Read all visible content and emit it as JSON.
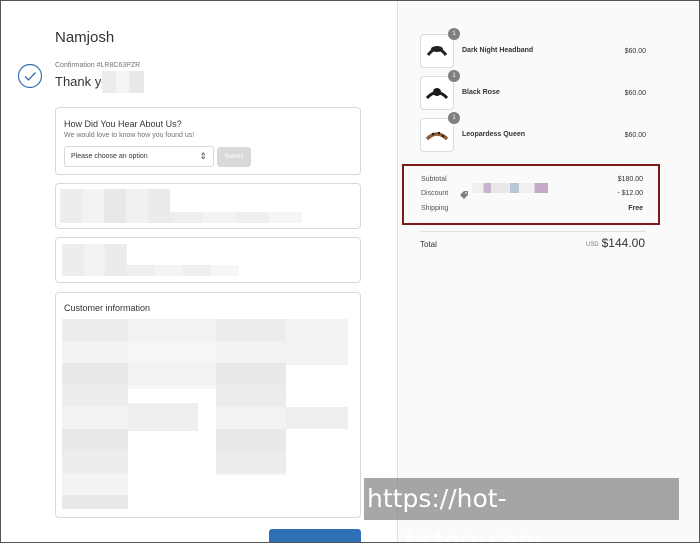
{
  "store": {
    "name": "Namjosh"
  },
  "confirmation": {
    "number": "Confirmation #LR8C63PZR",
    "thank_you": "Thank yo"
  },
  "survey": {
    "title": "How Did You Hear About Us?",
    "subtitle": "We would love to know how you found us!",
    "select_value": "Please choose an option",
    "submit_label": "Submit"
  },
  "customer_info": {
    "title": "Customer information"
  },
  "order": {
    "items": [
      {
        "name": "Dark Night Headband",
        "price": "$60.00",
        "qty": "1",
        "icon": "headband-product-icon"
      },
      {
        "name": "Black Rose",
        "price": "$60.00",
        "qty": "1",
        "icon": "headband-product-icon"
      },
      {
        "name": "Leopardess Queen",
        "price": "$60.00",
        "qty": "1",
        "icon": "headband-product-icon"
      }
    ],
    "summary": {
      "subtotal_label": "Subtotal",
      "subtotal_value": "$180.00",
      "discount_label": "Discount",
      "discount_value": "- $12.00",
      "shipping_label": "Shipping",
      "shipping_value": "Free"
    },
    "total": {
      "label": "Total",
      "currency": "USD",
      "value": "$144.00"
    }
  },
  "watermark": "https://hot-its.tistory.com",
  "colors": {
    "accent": "#2f6fb5",
    "highlight_border": "#7a1a1a"
  }
}
